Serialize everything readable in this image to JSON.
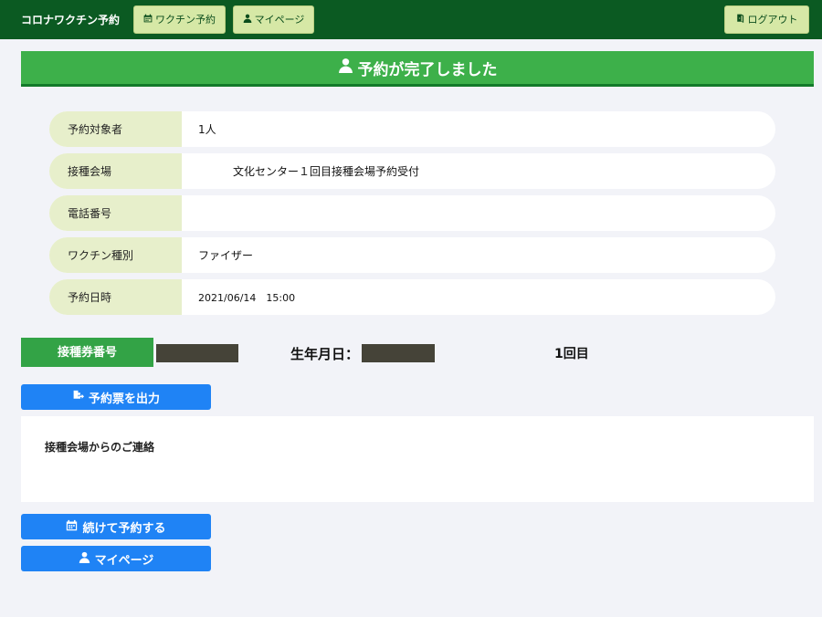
{
  "header": {
    "brand": "コロナワクチン予約",
    "nav": [
      {
        "label": "ワクチン予約",
        "icon": "calendar-icon"
      },
      {
        "label": "マイページ",
        "icon": "user-icon"
      }
    ],
    "logout": {
      "label": "ログアウト",
      "icon": "door-icon"
    }
  },
  "banner": {
    "title": "予約が完了しました",
    "icon": "user-icon"
  },
  "reservation": {
    "rows": [
      {
        "label": "予約対象者",
        "value": "1人"
      },
      {
        "label": "接種会場",
        "value": "文化センター１回目接種会場予約受付"
      },
      {
        "label": "電話番号",
        "value": ""
      },
      {
        "label": "ワクチン種別",
        "value": "ファイザー"
      },
      {
        "label": "予約日時",
        "value": "2021/06/14　15:00"
      }
    ]
  },
  "ticket": {
    "label": "接種券番号",
    "dob_label": "生年月日：",
    "dose": "1回目"
  },
  "buttons": {
    "print": {
      "label": "予約票を出力",
      "icon": "file-export-icon"
    },
    "continue": {
      "label": "続けて予約する",
      "icon": "calendar-icon"
    },
    "mypage": {
      "label": "マイページ",
      "icon": "user-icon"
    }
  },
  "notice": {
    "title": "接種会場からのご連絡"
  },
  "colors": {
    "header_bg": "#0b5a22",
    "banner_bg": "#3db04a",
    "button_blue": "#1f83f5",
    "label_bg": "#e7efcb"
  }
}
